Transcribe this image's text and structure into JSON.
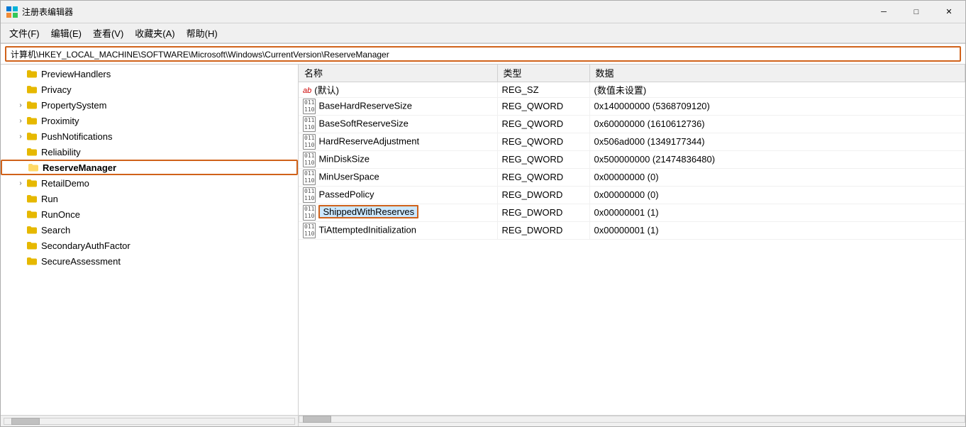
{
  "window": {
    "title": "注册表编辑器",
    "minimize_label": "─",
    "maximize_label": "□",
    "close_label": "✕"
  },
  "menu": {
    "items": [
      {
        "label": "文件(F)"
      },
      {
        "label": "编辑(E)"
      },
      {
        "label": "查看(V)"
      },
      {
        "label": "收藏夹(A)"
      },
      {
        "label": "帮助(H)"
      }
    ]
  },
  "address": {
    "value": "计算机\\HKEY_LOCAL_MACHINE\\SOFTWARE\\Microsoft\\Windows\\CurrentVersion\\ReserveManager"
  },
  "tree": {
    "items": [
      {
        "label": "PreviewHandlers",
        "level": 1,
        "hasArrow": false,
        "arrowChar": "",
        "selected": false
      },
      {
        "label": "Privacy",
        "level": 1,
        "hasArrow": false,
        "arrowChar": "",
        "selected": false
      },
      {
        "label": "PropertySystem",
        "level": 1,
        "hasArrow": true,
        "arrowChar": "›",
        "selected": false
      },
      {
        "label": "Proximity",
        "level": 1,
        "hasArrow": true,
        "arrowChar": "›",
        "selected": false
      },
      {
        "label": "PushNotifications",
        "level": 1,
        "hasArrow": true,
        "arrowChar": "›",
        "selected": false
      },
      {
        "label": "Reliability",
        "level": 1,
        "hasArrow": false,
        "arrowChar": "",
        "selected": false
      },
      {
        "label": "ReserveManager",
        "level": 1,
        "hasArrow": false,
        "arrowChar": "",
        "selected": true
      },
      {
        "label": "RetailDemo",
        "level": 1,
        "hasArrow": true,
        "arrowChar": "›",
        "selected": false
      },
      {
        "label": "Run",
        "level": 1,
        "hasArrow": false,
        "arrowChar": "",
        "selected": false
      },
      {
        "label": "RunOnce",
        "level": 1,
        "hasArrow": false,
        "arrowChar": "",
        "selected": false
      },
      {
        "label": "Search",
        "level": 1,
        "hasArrow": false,
        "arrowChar": "",
        "selected": false
      },
      {
        "label": "SecondaryAuthFactor",
        "level": 1,
        "hasArrow": false,
        "arrowChar": "",
        "selected": false
      },
      {
        "label": "SecureAssessment",
        "level": 1,
        "hasArrow": false,
        "arrowChar": "",
        "selected": false
      }
    ]
  },
  "values_table": {
    "headers": [
      "名称",
      "类型",
      "数据"
    ],
    "rows": [
      {
        "icon_type": "ab",
        "name": "(默认)",
        "type": "REG_SZ",
        "data": "(数值未设置)",
        "selected": false
      },
      {
        "icon_type": "reg",
        "name": "BaseHardReserveSize",
        "type": "REG_QWORD",
        "data": "0x140000000 (5368709120)",
        "selected": false
      },
      {
        "icon_type": "reg",
        "name": "BaseSoftReserveSize",
        "type": "REG_QWORD",
        "data": "0x60000000 (1610612736)",
        "selected": false
      },
      {
        "icon_type": "reg",
        "name": "HardReserveAdjustment",
        "type": "REG_QWORD",
        "data": "0x506ad000 (1349177344)",
        "selected": false
      },
      {
        "icon_type": "reg",
        "name": "MinDiskSize",
        "type": "REG_QWORD",
        "data": "0x500000000 (21474836480)",
        "selected": false
      },
      {
        "icon_type": "reg",
        "name": "MinUserSpace",
        "type": "REG_QWORD",
        "data": "0x00000000 (0)",
        "selected": false
      },
      {
        "icon_type": "reg",
        "name": "PassedPolicy",
        "type": "REG_DWORD",
        "data": "0x00000000 (0)",
        "selected": false
      },
      {
        "icon_type": "reg",
        "name": "ShippedWithReserves",
        "type": "REG_DWORD",
        "data": "0x00000001 (1)",
        "selected": true
      },
      {
        "icon_type": "reg",
        "name": "TiAttemptedInitialization",
        "type": "REG_DWORD",
        "data": "0x00000001 (1)",
        "selected": false
      }
    ]
  }
}
